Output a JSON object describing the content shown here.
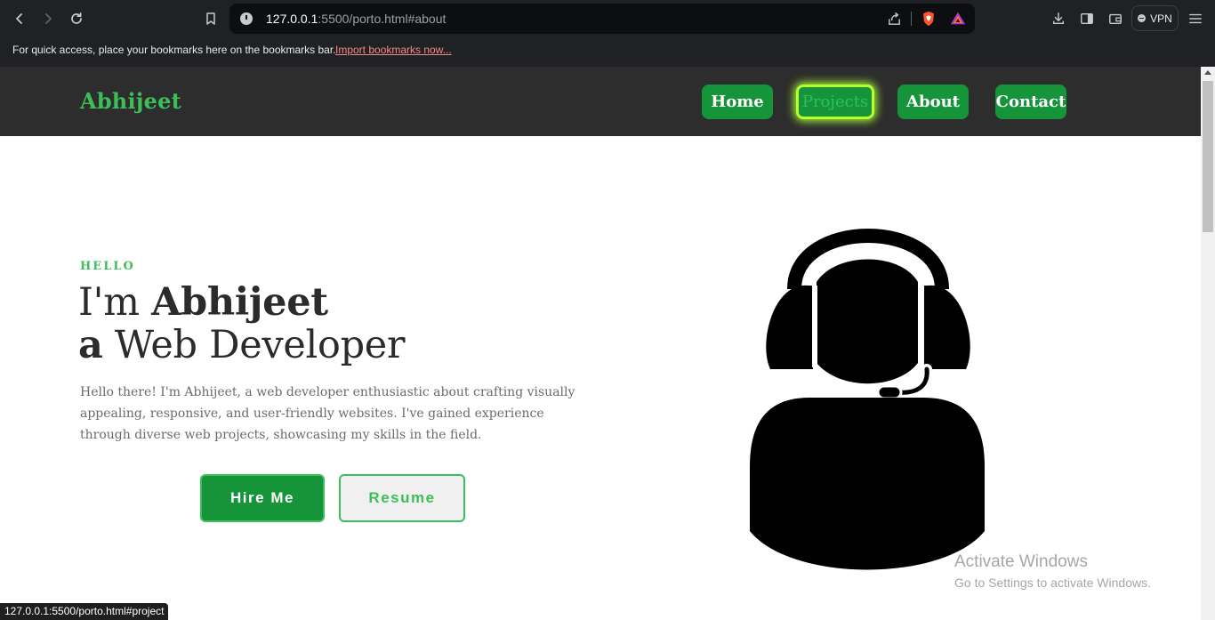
{
  "browser": {
    "url_host": "127.0.0.1",
    "url_rest": ":5500/porto.html#about",
    "vpn_label": "VPN",
    "bookmarks_message": "For quick access, place your bookmarks here on the bookmarks bar.",
    "bookmarks_link": "Import bookmarks now...",
    "icons": [
      "back-icon",
      "forward-icon",
      "reload-icon",
      "bookmark-icon",
      "site-info-icon",
      "share-icon",
      "brave-shields-icon",
      "brave-rewards-icon",
      "download-icon",
      "sidebar-icon",
      "wallet-icon",
      "menu-icon"
    ]
  },
  "site": {
    "logo": "Abhijeet",
    "nav": [
      {
        "label": "Home"
      },
      {
        "label": "Projects",
        "active": true
      },
      {
        "label": "About"
      },
      {
        "label": "Contact"
      }
    ],
    "accent_color": "#3dbe59",
    "button_color": "#16943a"
  },
  "hero": {
    "greeting": "HELLO",
    "line1_prefix": "I'm ",
    "line1_name": "Abhijeet",
    "line2_prefix": "a",
    "line2_role": " Web Developer",
    "intro": "Hello there! I'm Abhijeet, a web developer enthusiastic about crafting visually appealing, responsive, and user-friendly websites. I've gained experience through diverse web projects, showcasing my skills in the field.",
    "hire_button": "Hire Me",
    "resume_button": "Resume"
  },
  "watermark": {
    "title": "Activate Windows",
    "subtitle": "Go to Settings to activate Windows."
  },
  "status_bar": {
    "link_preview": "127.0.0.1:5500/porto.html#project"
  }
}
